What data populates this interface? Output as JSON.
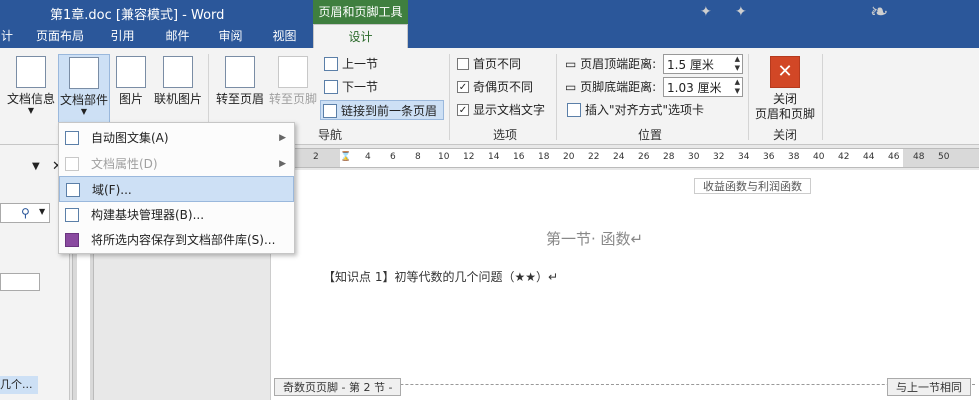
{
  "window": {
    "title": "第1章.doc [兼容模式] - Word",
    "contextual_group": "页眉和页脚工具"
  },
  "tabs": [
    {
      "label": "计"
    },
    {
      "label": "页面布局"
    },
    {
      "label": "引用"
    },
    {
      "label": "邮件"
    },
    {
      "label": "审阅"
    },
    {
      "label": "视图"
    },
    {
      "label": "设计"
    }
  ],
  "ribbon": {
    "insert": {
      "doc_info": "文档信息",
      "doc_parts": "文档部件",
      "picture": "图片",
      "online_picture": "联机图片"
    },
    "nav": {
      "goto_header": "转至页眉",
      "goto_footer": "转至页脚",
      "prev": "上一节",
      "next": "下一节",
      "link_prev": "链接到前一条页眉",
      "group": "导航"
    },
    "options": {
      "first_page": "首页不同",
      "odd_even": "奇偶页不同",
      "show_text": "显示文档文字",
      "group": "选项"
    },
    "position": {
      "header_top_label": "页眉顶端距离:",
      "header_top_value": "1.5 厘米",
      "footer_bottom_label": "页脚底端距离:",
      "footer_bottom_value": "1.03 厘米",
      "insert_tab": "插入\"对齐方式\"选项卡",
      "group": "位置"
    },
    "close": {
      "label1": "关闭",
      "label2": "页眉和页脚",
      "group": "关闭"
    }
  },
  "dropdown": {
    "items": [
      {
        "label": "自动图文集(A)"
      },
      {
        "label": "文档属性(D)"
      },
      {
        "label": "域(F)..."
      },
      {
        "label": "构建基块管理器(B)..."
      },
      {
        "label": "将所选内容保存到文档部件库(S)..."
      }
    ]
  },
  "ruler": {
    "ticks": [
      "2",
      "2",
      "4",
      "6",
      "8",
      "10",
      "12",
      "14",
      "16",
      "18",
      "20",
      "22",
      "24",
      "26",
      "28",
      "30",
      "32",
      "34",
      "36",
      "38",
      "40",
      "42",
      "44",
      "46",
      "48",
      "50"
    ]
  },
  "document": {
    "header_text": "收益函数与利润函数",
    "section_title": "第一节· 函数↵",
    "body_line": "【知识点 1】初等代数的几个问题（★★）↵",
    "footer_left": "奇数页页脚 - 第 2 节 -",
    "footer_right": "与上一节相同"
  },
  "nav_pane": {
    "selected_item": "几个..."
  }
}
